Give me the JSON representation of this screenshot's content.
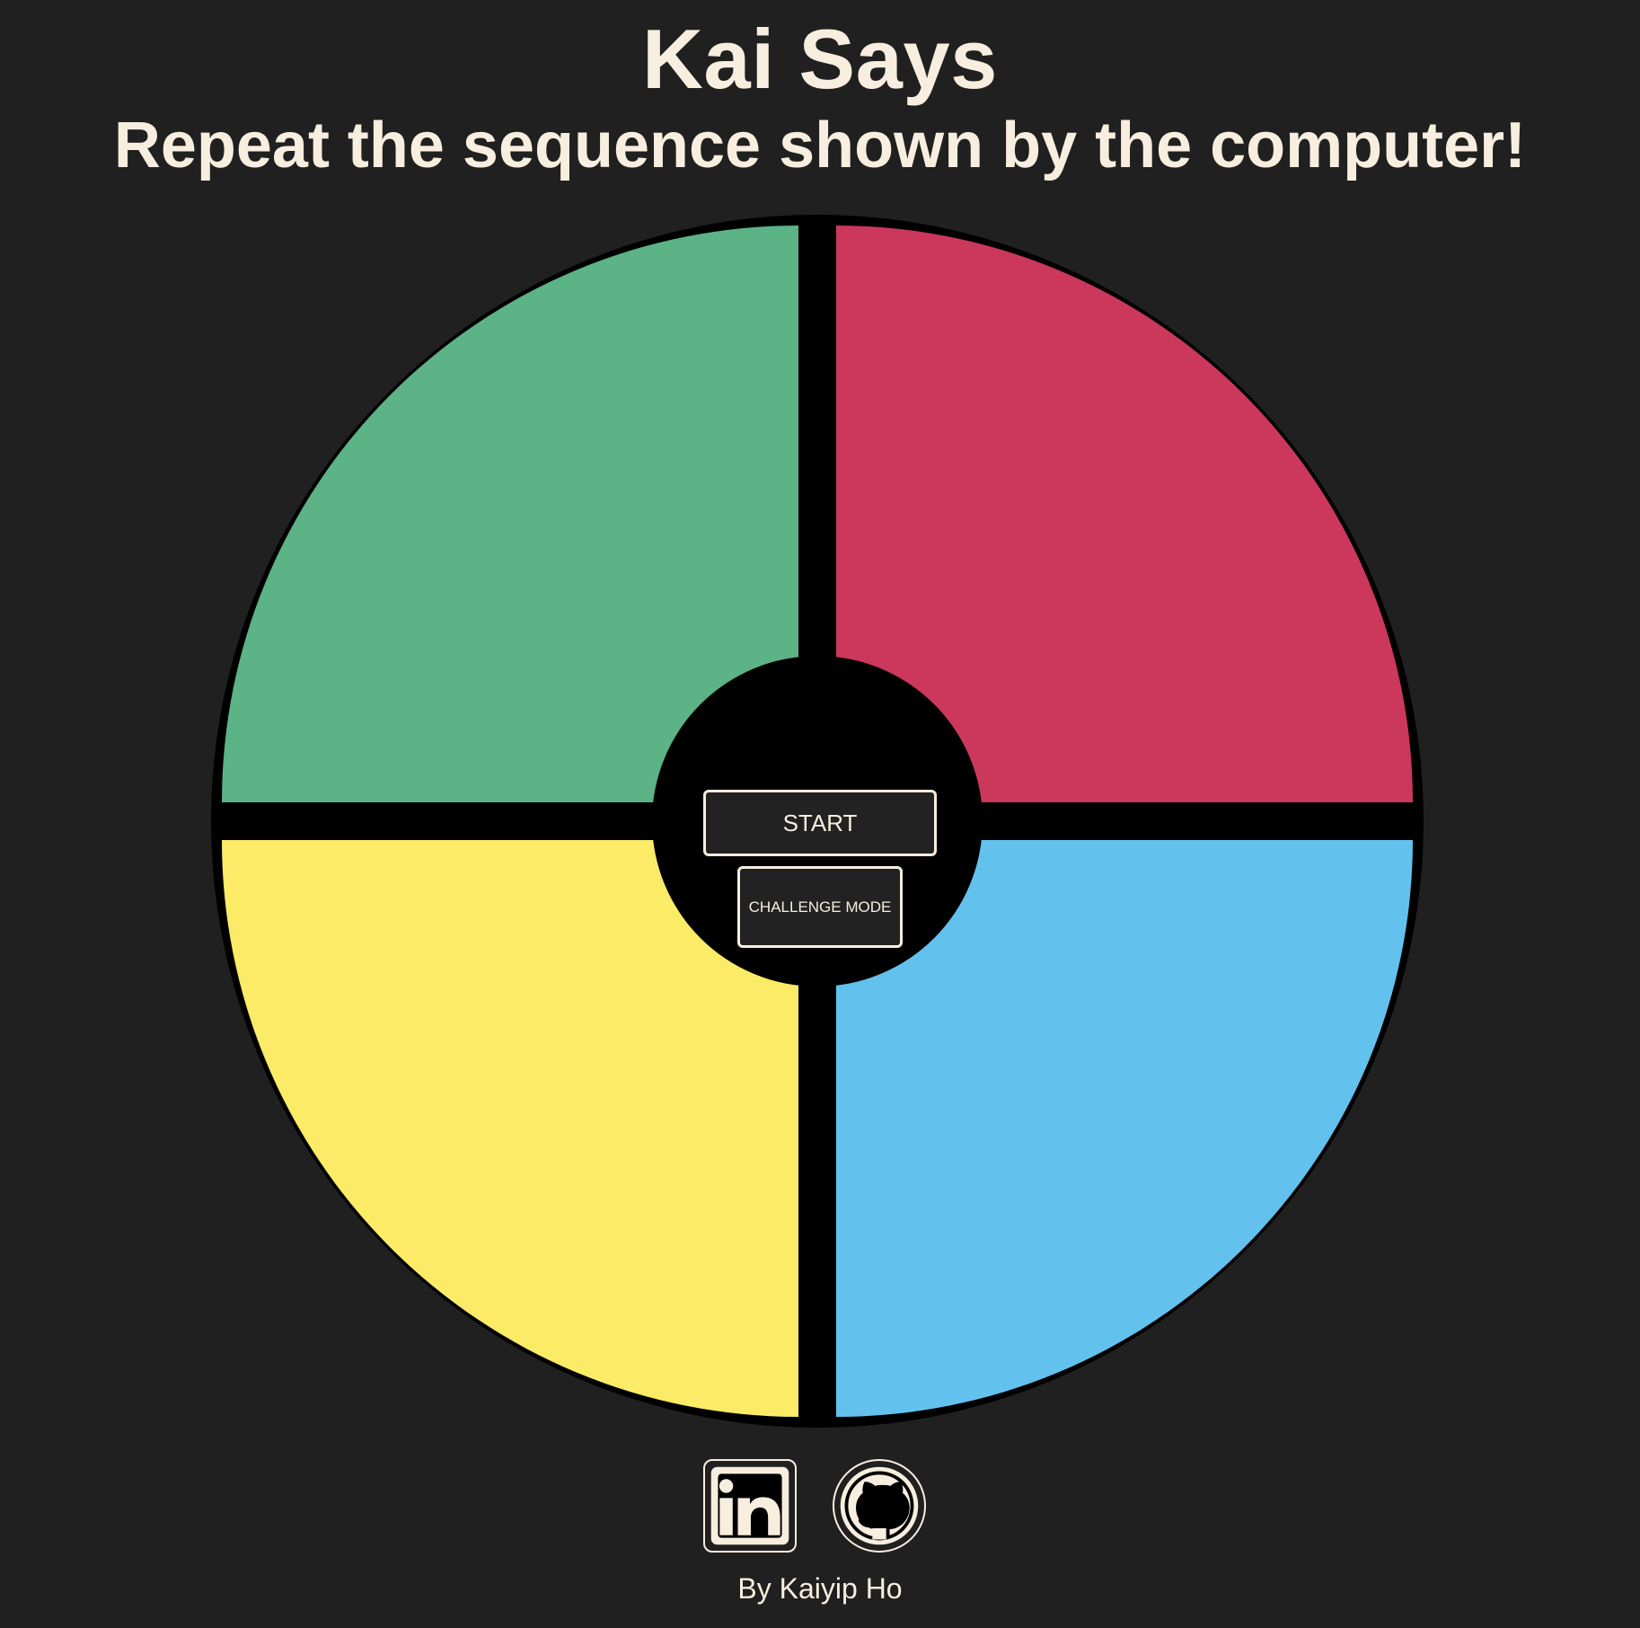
{
  "header": {
    "title": "Kai Says",
    "subtitle": "Repeat the sequence shown by the computer!"
  },
  "board": {
    "quadrants": [
      {
        "name": "green",
        "color": "#5cb385"
      },
      {
        "name": "red",
        "color": "#cc375c"
      },
      {
        "name": "yellow",
        "color": "#fceb66"
      },
      {
        "name": "blue",
        "color": "#63c1ed"
      }
    ],
    "start_label": "START",
    "challenge_label": "CHALLENGE MODE"
  },
  "footer": {
    "social": [
      {
        "name": "linkedin-icon"
      },
      {
        "name": "github-icon"
      }
    ],
    "byline": "By Kaiyip Ho"
  },
  "colors": {
    "background": "#202020",
    "text": "#f8eedf",
    "board_border": "#000000"
  }
}
